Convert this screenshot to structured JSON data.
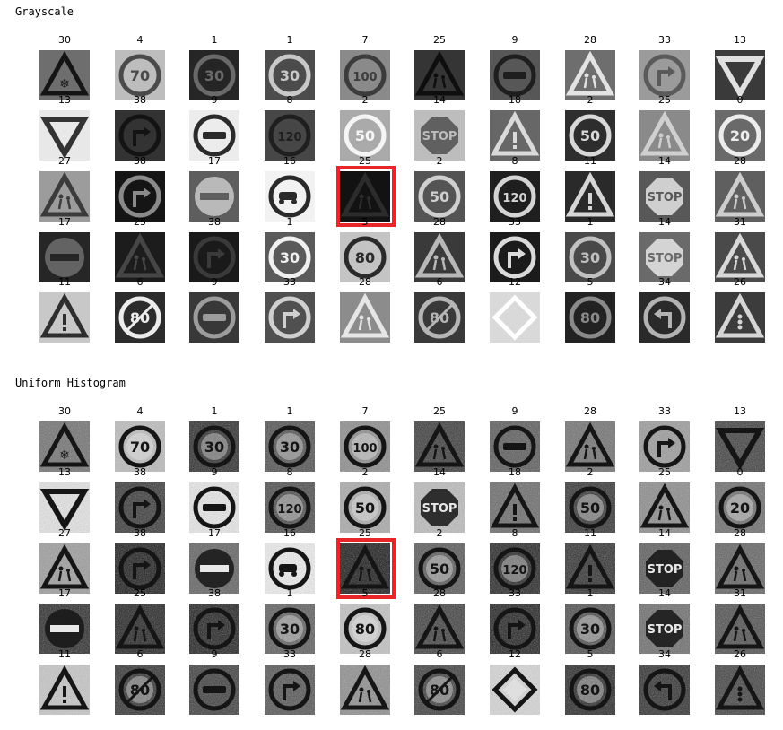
{
  "sections": [
    {
      "title": "Grayscale"
    },
    {
      "title": "Uniform Histogram"
    }
  ],
  "grid": {
    "rows": [
      [
        {
          "label": "30",
          "icon": "snowflake-triangle-sign-icon",
          "bg": "#6e6e6e",
          "tone": "#141414"
        },
        {
          "label": "4",
          "icon": "speed-limit-70-sign-icon",
          "bg": "#bdbdbd",
          "tone": "#4a4a4a"
        },
        {
          "label": "1",
          "icon": "speed-limit-30-sign-icon",
          "bg": "#262626",
          "tone": "#6a6a6a"
        },
        {
          "label": "1",
          "icon": "speed-limit-30-sign-icon",
          "bg": "#4c4c4c",
          "tone": "#c8c8c8"
        },
        {
          "label": "7",
          "icon": "speed-limit-100-sign-icon",
          "bg": "#8a8a8a",
          "tone": "#3c3c3c"
        },
        {
          "label": "25",
          "icon": "road-work-sign-icon",
          "bg": "#353535",
          "tone": "#0e0e0e"
        },
        {
          "label": "9",
          "icon": "no-overtaking-sign-icon",
          "bg": "#575757",
          "tone": "#1e1e1e"
        },
        {
          "label": "28",
          "icon": "children-crossing-sign-icon",
          "bg": "#6e6e6e",
          "tone": "#e3e3e3"
        },
        {
          "label": "33",
          "icon": "turn-right-sign-icon",
          "bg": "#9b9b9b",
          "tone": "#5a5a5a"
        },
        {
          "label": "13",
          "icon": "yield-sign-icon",
          "bg": "#3a3a3a",
          "tone": "#e0e0e0"
        }
      ],
      [
        {
          "label": "13",
          "icon": "yield-sign-icon",
          "bg": "#e8e8e8",
          "tone": "#333333"
        },
        {
          "label": "38",
          "icon": "keep-right-sign-icon",
          "bg": "#333333",
          "tone": "#131313"
        },
        {
          "label": "9",
          "icon": "no-overtaking-sign-icon",
          "bg": "#ececec",
          "tone": "#2b2b2b"
        },
        {
          "label": "8",
          "icon": "speed-limit-120-sign-icon",
          "bg": "#474747",
          "tone": "#1f1f1f"
        },
        {
          "label": "2",
          "icon": "speed-limit-50-sign-icon",
          "bg": "#aaaaaa",
          "tone": "#f5f5f5"
        },
        {
          "label": "14",
          "icon": "stop-sign-icon",
          "bg": "#bdbdbd",
          "tone": "#505050"
        },
        {
          "label": "18",
          "icon": "general-caution-sign-icon",
          "bg": "#676767",
          "tone": "#dadada"
        },
        {
          "label": "2",
          "icon": "speed-limit-50-sign-icon",
          "bg": "#2e2e2e",
          "tone": "#d8d8d8"
        },
        {
          "label": "25",
          "icon": "road-work-sign-icon",
          "bg": "#8a8a8a",
          "tone": "#d0d0d0"
        },
        {
          "label": "0",
          "icon": "speed-limit-20-sign-icon",
          "bg": "#6a6a6a",
          "tone": "#ededed"
        }
      ],
      [
        {
          "label": "27",
          "icon": "pedestrians-sign-icon",
          "bg": "#9c9c9c",
          "tone": "#3b3b3b"
        },
        {
          "label": "38",
          "icon": "keep-right-sign-icon",
          "bg": "#151515",
          "tone": "#8a8a8a"
        },
        {
          "label": "17",
          "icon": "no-entry-sign-icon",
          "bg": "#5e5e5e",
          "tone": "#c9c9c9"
        },
        {
          "label": "16",
          "icon": "no-trucks-sign-icon",
          "bg": "#f2f2f2",
          "tone": "#2a2a2a"
        },
        {
          "label": "25",
          "icon": "road-work-sign-icon",
          "bg": "#121212",
          "tone": "#2c2c2c"
        },
        {
          "label": "2",
          "icon": "speed-limit-50-sign-icon",
          "bg": "#545454",
          "tone": "#cfcfcf"
        },
        {
          "label": "8",
          "icon": "speed-limit-120-sign-icon",
          "bg": "#1f1f1f",
          "tone": "#d4d4d4"
        },
        {
          "label": "11",
          "icon": "right-of-way-sign-icon",
          "bg": "#2a2a2a",
          "tone": "#d6d6d6"
        },
        {
          "label": "14",
          "icon": "stop-sign-icon",
          "bg": "#585858",
          "tone": "#e4e4e4"
        },
        {
          "label": "28",
          "icon": "children-crossing-sign-icon",
          "bg": "#5f5f5f",
          "tone": "#cdcdcd"
        }
      ],
      [
        {
          "label": "17",
          "icon": "no-entry-sign-icon",
          "bg": "#262626",
          "tone": "#6f6f6f"
        },
        {
          "label": "25",
          "icon": "road-work-sign-icon",
          "bg": "#1c1c1c",
          "tone": "#464646"
        },
        {
          "label": "38",
          "icon": "keep-right-sign-icon",
          "bg": "#1a1a1a",
          "tone": "#3a3a3a"
        },
        {
          "label": "1",
          "icon": "speed-limit-30-sign-icon",
          "bg": "#5a5a5a",
          "tone": "#f0f0f0"
        },
        {
          "label": "5",
          "icon": "speed-limit-80-sign-icon",
          "bg": "#c4c4c4",
          "tone": "#2a2a2a"
        },
        {
          "label": "28",
          "icon": "children-crossing-sign-icon",
          "bg": "#3a3a3a",
          "tone": "#b8b8b8"
        },
        {
          "label": "33",
          "icon": "turn-right-sign-icon",
          "bg": "#1b1b1b",
          "tone": "#dadada"
        },
        {
          "label": "1",
          "icon": "speed-limit-30-sign-icon",
          "bg": "#494949",
          "tone": "#c0c0c0"
        },
        {
          "label": "14",
          "icon": "stop-sign-icon",
          "bg": "#6a6a6a",
          "tone": "#e6e6e6"
        },
        {
          "label": "31",
          "icon": "wild-animals-sign-icon",
          "bg": "#4a4a4a",
          "tone": "#d8d8d8"
        }
      ],
      [
        {
          "label": "11",
          "icon": "right-of-way-sign-icon",
          "bg": "#c8c8c8",
          "tone": "#2e2e2e"
        },
        {
          "label": "6",
          "icon": "end-of-speed-limit-80-sign-icon",
          "bg": "#2c2c2c",
          "tone": "#ececec"
        },
        {
          "label": "9",
          "icon": "no-overtaking-sign-icon",
          "bg": "#383838",
          "tone": "#9c9c9c"
        },
        {
          "label": "33",
          "icon": "turn-right-sign-icon",
          "bg": "#505050",
          "tone": "#cfcfcf"
        },
        {
          "label": "28",
          "icon": "children-crossing-sign-icon",
          "bg": "#8c8c8c",
          "tone": "#e6e6e6"
        },
        {
          "label": "6",
          "icon": "end-of-speed-limit-80-sign-icon",
          "bg": "#393939",
          "tone": "#b5b5b5"
        },
        {
          "label": "12",
          "icon": "priority-road-sign-icon",
          "bg": "#d9d9d9",
          "tone": "#ffffff"
        },
        {
          "label": "5",
          "icon": "speed-limit-80-sign-icon",
          "bg": "#222222",
          "tone": "#8a8a8a"
        },
        {
          "label": "34",
          "icon": "turn-left-sign-icon",
          "bg": "#2a2a2a",
          "tone": "#b2b2b2"
        },
        {
          "label": "26",
          "icon": "traffic-signals-sign-icon",
          "bg": "#3c3c3c",
          "tone": "#d5d5d5"
        }
      ]
    ]
  },
  "highlight": {
    "row": 2,
    "col": 4,
    "color": "#e8262a"
  }
}
